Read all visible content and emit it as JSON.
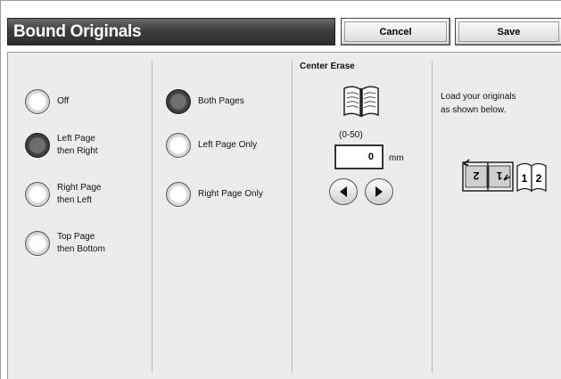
{
  "header": {
    "title": "Bound Originals",
    "cancel_label": "Cancel",
    "save_label": "Save"
  },
  "scan_order": {
    "options": [
      {
        "label_line1": "Off",
        "label_line2": "",
        "selected": false
      },
      {
        "label_line1": "Left Page",
        "label_line2": "then Right",
        "selected": true
      },
      {
        "label_line1": "Right Page",
        "label_line2": "then Left",
        "selected": false
      },
      {
        "label_line1": "Top Page",
        "label_line2": "then Bottom",
        "selected": false
      }
    ]
  },
  "pages": {
    "options": [
      {
        "label": "Both Pages",
        "selected": true
      },
      {
        "label": "Left Page Only",
        "selected": false
      },
      {
        "label": "Right Page Only",
        "selected": false
      }
    ]
  },
  "center_erase": {
    "title": "Center Erase",
    "range": "(0-50)",
    "value": "0",
    "unit": "mm"
  },
  "instructions": {
    "line1": "Load your originals",
    "line2": "as shown below."
  },
  "diagram": {
    "page_left": "2",
    "page_right": "1",
    "book_left": "1",
    "book_right": "2"
  },
  "colors": {
    "title_bar": "#3e3e3e",
    "panel": "#ececec",
    "selected_radio": "#3f3f3f"
  }
}
